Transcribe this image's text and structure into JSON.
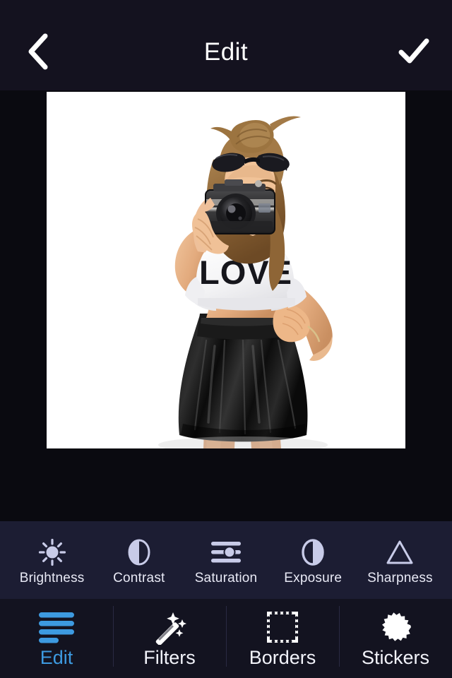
{
  "app": {
    "screen_title": "Edit",
    "theme": {
      "header_bg": "#14121f",
      "canvas_bg": "#0a0a10",
      "tools_bg": "#1c1d33",
      "nav_bg": "#131320",
      "accent": "#3d9ae0",
      "icon_color": "#c8cbe8",
      "text_color": "#ffffff"
    }
  },
  "header": {
    "title": "Edit",
    "back_icon": "chevron-left-icon",
    "done_icon": "checkmark-icon"
  },
  "photo": {
    "alt": "Young woman with hair bun and sunglasses on head holding a vintage camera to her eye, wearing a white LOVE crop top and black leather skater skirt on a white background",
    "shirt_text": "LOVE",
    "background": "#ffffff"
  },
  "tools": {
    "items": [
      {
        "label": "Brightness",
        "icon": "sun-icon"
      },
      {
        "label": "Contrast",
        "icon": "contrast-half-circle-icon"
      },
      {
        "label": "Saturation",
        "icon": "slider-lines-icon"
      },
      {
        "label": "Exposure",
        "icon": "exposure-half-circle-icon"
      },
      {
        "label": "Sharpness",
        "icon": "triangle-icon"
      }
    ]
  },
  "nav": {
    "items": [
      {
        "label": "Edit",
        "icon": "sliders-bars-icon",
        "active": true
      },
      {
        "label": "Filters",
        "icon": "magic-wand-icon",
        "active": false
      },
      {
        "label": "Borders",
        "icon": "stamp-frame-icon",
        "active": false
      },
      {
        "label": "Stickers",
        "icon": "starburst-icon",
        "active": false
      }
    ]
  }
}
